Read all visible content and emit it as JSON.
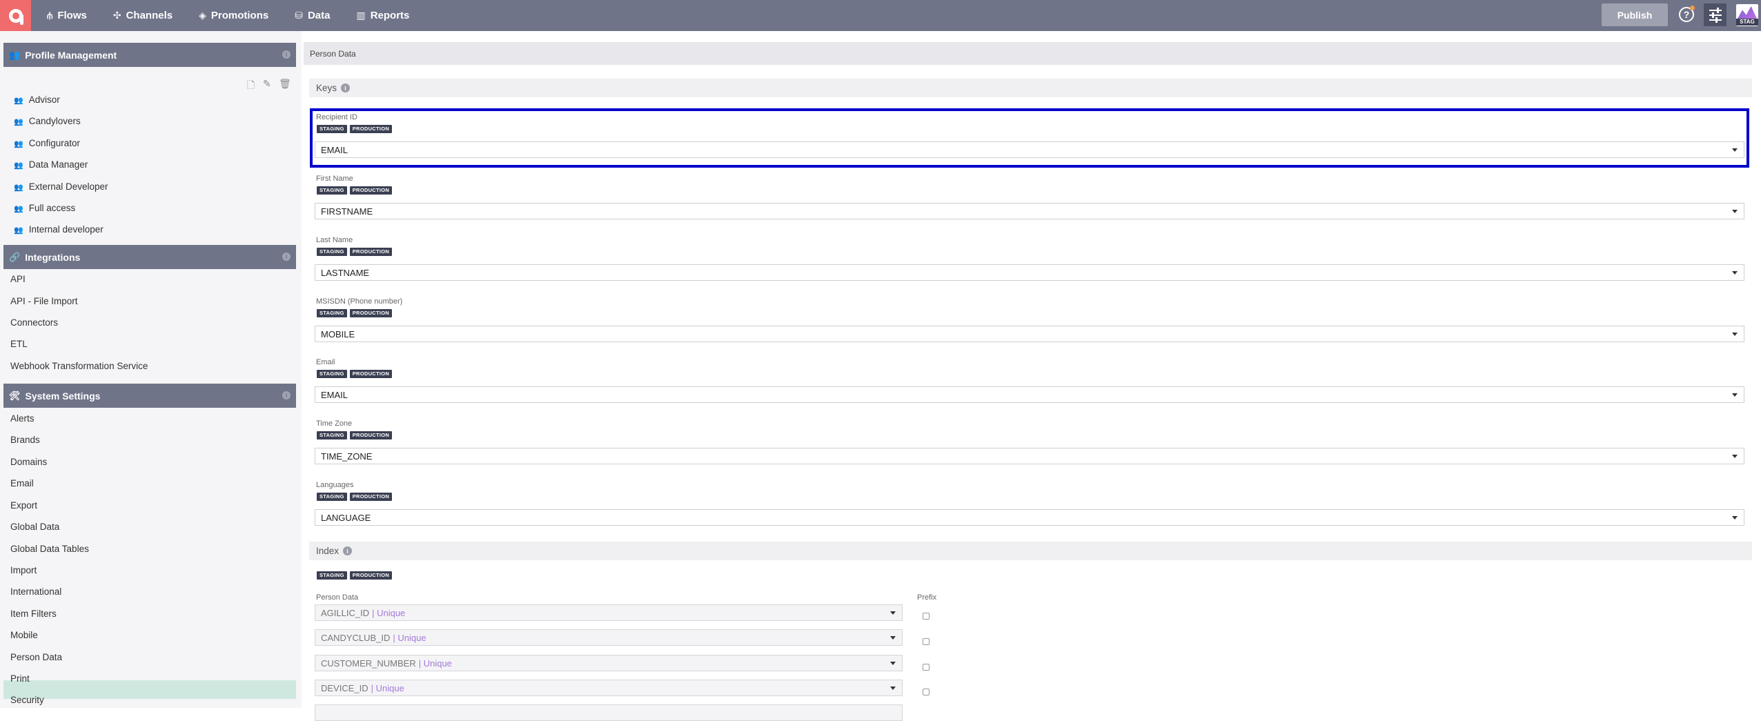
{
  "nav": {
    "items": [
      {
        "label": "Flows",
        "icon": "flows-icon"
      },
      {
        "label": "Channels",
        "icon": "channels-icon"
      },
      {
        "label": "Promotions",
        "icon": "promotions-icon"
      },
      {
        "label": "Data",
        "icon": "data-icon"
      },
      {
        "label": "Reports",
        "icon": "reports-icon"
      }
    ],
    "publish_label": "Publish",
    "help_label": "?",
    "env_label": "STAG"
  },
  "sidebar": {
    "profile_management": "Profile Management",
    "roles": [
      "Advisor",
      "Candylovers",
      "Configurator",
      "Data Manager",
      "External Developer",
      "Full access",
      "Internal developer"
    ],
    "integrations": "Integrations",
    "integration_items": [
      "API",
      "API - File Import",
      "Connectors",
      "ETL",
      "Webhook Transformation Service"
    ],
    "system_settings": "System Settings",
    "system_items": [
      "Alerts",
      "Brands",
      "Domains",
      "Email",
      "Export",
      "Global Data",
      "Global Data Tables",
      "Import",
      "International",
      "Item Filters",
      "Mobile",
      "Person Data",
      "Print",
      "Security"
    ],
    "active_item": "Person Data"
  },
  "main": {
    "panel_title": "Person Data",
    "keys_title": "Keys",
    "staging": "STAGING",
    "production": "PRODUCTION",
    "fields": [
      {
        "label": "Recipient ID",
        "value": "EMAIL"
      },
      {
        "label": "First Name",
        "value": "FIRSTNAME"
      },
      {
        "label": "Last Name",
        "value": "LASTNAME"
      },
      {
        "label": "MSISDN (Phone number)",
        "value": "MOBILE"
      },
      {
        "label": "Email",
        "value": "EMAIL"
      },
      {
        "label": "Time Zone",
        "value": "TIME_ZONE"
      },
      {
        "label": "Languages",
        "value": "LANGUAGE"
      }
    ],
    "index_title": "Index",
    "person_data_label": "Person Data",
    "prefix_label": "Prefix",
    "index_rows": [
      {
        "value": "AGILLIC_ID",
        "unique": "| Unique"
      },
      {
        "value": "CANDYCLUB_ID",
        "unique": "| Unique"
      },
      {
        "value": "CUSTOMER_NUMBER",
        "unique": "| Unique"
      },
      {
        "value": "DEVICE_ID",
        "unique": "| Unique"
      }
    ]
  }
}
